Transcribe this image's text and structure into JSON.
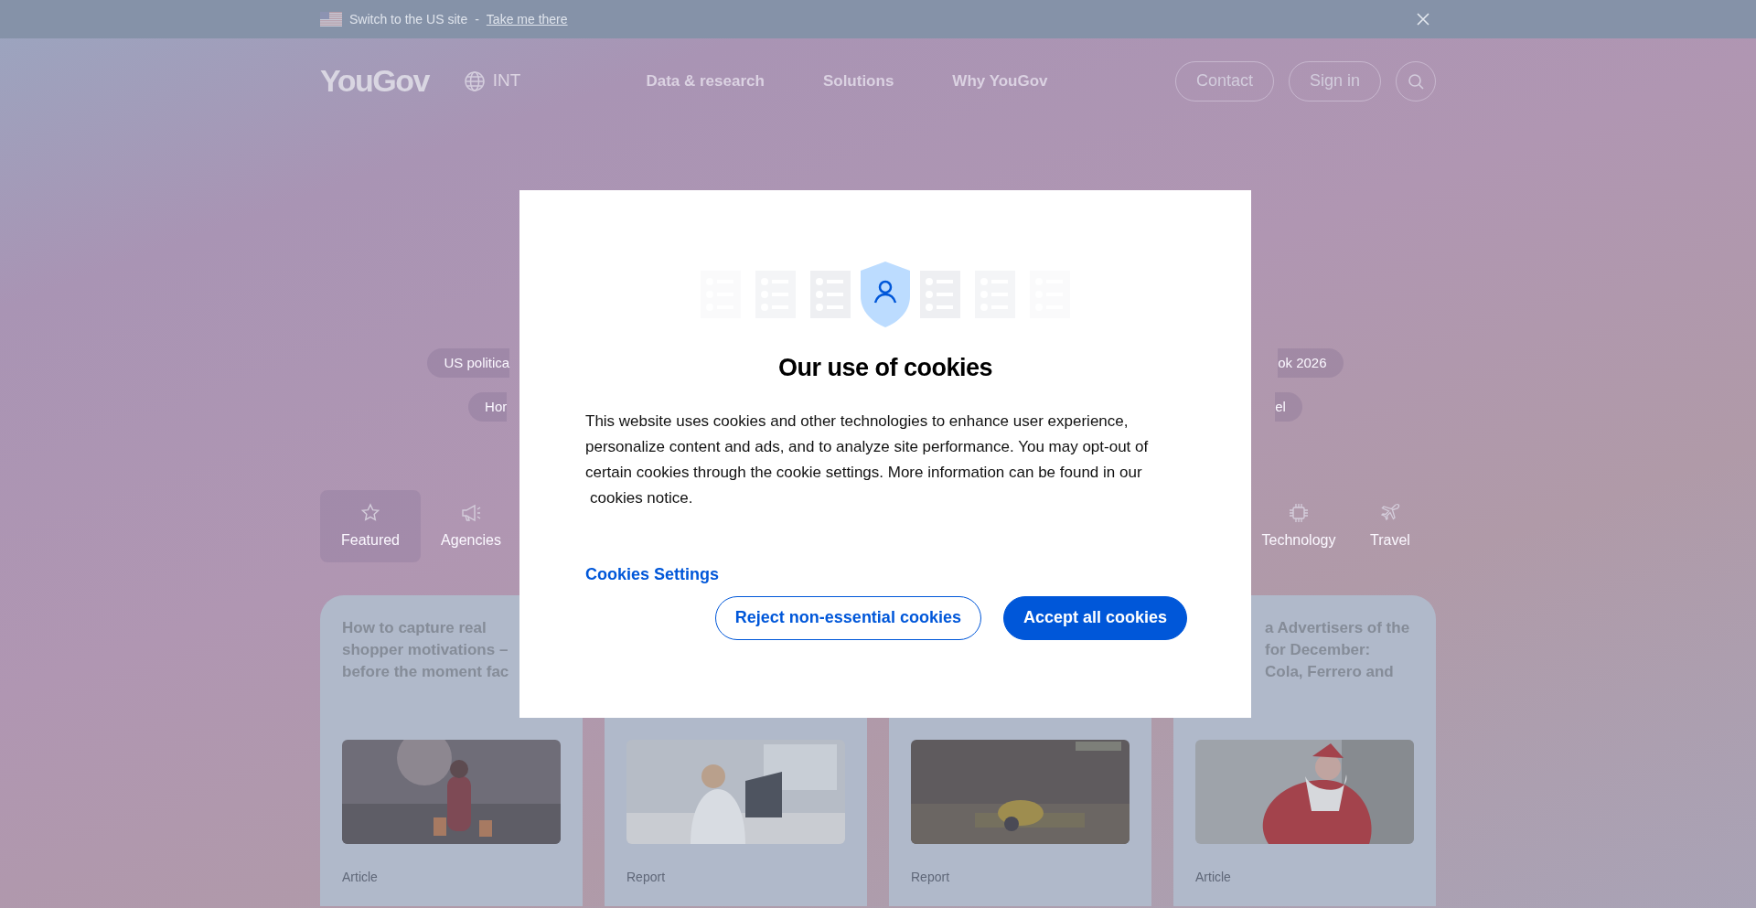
{
  "top_banner": {
    "text": "Switch to the US site",
    "separator": "-",
    "link": "Take me there"
  },
  "nav": {
    "logo": "YouGov",
    "region": "INT",
    "links": [
      "Data & research",
      "Solutions",
      "Why YouGov"
    ],
    "buttons": [
      "Contact",
      "Sign in"
    ]
  },
  "topic_chip_rows": [
    {
      "left": "US politica",
      "right": "ok 2026"
    },
    {
      "left": "Hor",
      "right": "el"
    }
  ],
  "categories": [
    {
      "label": "Featured",
      "selected": true
    },
    {
      "label": "Agencies",
      "selected": false
    },
    {
      "label": "Technology",
      "selected": false
    },
    {
      "label": "Travel",
      "selected": false
    }
  ],
  "cards": [
    {
      "title_lines": [
        "How to capture real",
        "shopper motivations –",
        "before the moment fac"
      ],
      "label": "Article"
    },
    {
      "label": "Report"
    },
    {
      "label": "Report"
    },
    {
      "title_lines": [
        "a Advertisers of the",
        "for December:",
        "Cola, Ferrero and"
      ],
      "label": "Article"
    }
  ],
  "cookie_dialog": {
    "title": "Our use of cookies",
    "body": "This website uses cookies and other technologies to enhance user experience, personalize content and ads, and to analyze site performance. You may opt-out of certain cookies through the cookie settings. More information can be found in our",
    "link": "cookies notice.",
    "settings_link": "Cookies Settings",
    "buttons": [
      {
        "label": "Reject non-essential cookies",
        "kind": "outline"
      },
      {
        "label": "Accept all cookies",
        "kind": "primary"
      }
    ]
  }
}
